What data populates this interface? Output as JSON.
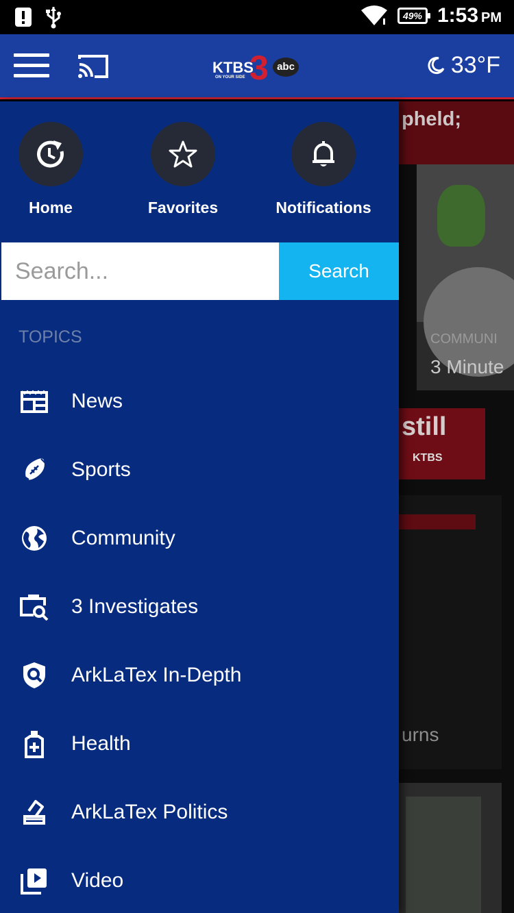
{
  "status_bar": {
    "time": "1:53",
    "ampm": "PM",
    "battery": "49%"
  },
  "app_bar": {
    "logo_text": "KTBS",
    "logo_number": "3",
    "logo_network": "abc",
    "logo_tagline": "ON YOUR SIDE",
    "temperature": "33°F"
  },
  "drawer": {
    "quick_actions": [
      {
        "label": "Home",
        "icon": "refresh-clock-icon"
      },
      {
        "label": "Favorites",
        "icon": "star-icon"
      },
      {
        "label": "Notifications",
        "icon": "bell-icon"
      }
    ],
    "search": {
      "placeholder": "Search...",
      "button_label": "Search"
    },
    "topics_header": "TOPICS",
    "topics": [
      {
        "label": "News",
        "icon": "newspaper-icon"
      },
      {
        "label": "Sports",
        "icon": "football-icon"
      },
      {
        "label": "Community",
        "icon": "globe-icon"
      },
      {
        "label": "3 Investigates",
        "icon": "briefcase-search-icon"
      },
      {
        "label": "ArkLaTex In-Depth",
        "icon": "shield-search-icon"
      },
      {
        "label": "Health",
        "icon": "medicine-bottle-icon"
      },
      {
        "label": "ArkLaTex Politics",
        "icon": "ballot-vote-icon"
      },
      {
        "label": "Video",
        "icon": "video-library-icon"
      }
    ]
  },
  "background": {
    "banner_text": "pheld;",
    "card1_category": "COMMUNI",
    "card1_title": "3 Minute",
    "ad_text": "still",
    "ad_logo": "KTBS",
    "card2_text": "urns"
  },
  "colors": {
    "app_bar": "#1b3fa0",
    "drawer": "#062b7f",
    "search_button": "#13b4f0",
    "accent_red": "#c9202f"
  }
}
